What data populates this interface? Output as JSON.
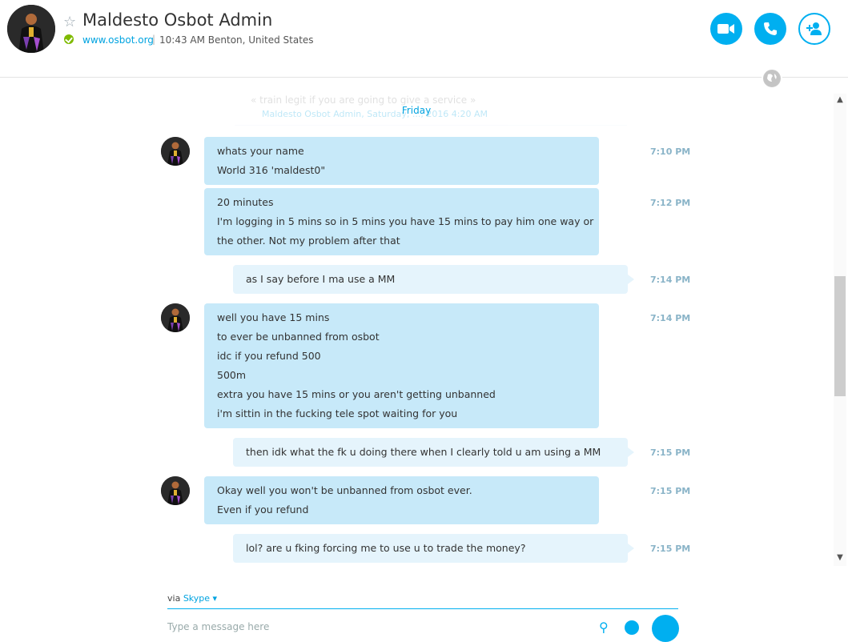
{
  "header": {
    "title": "Maldesto Osbot Admin",
    "website": "www.osbot.org",
    "separator": "|",
    "location": "10:43 AM Benton, United States"
  },
  "icons": {
    "star": "star-icon",
    "status": "online-status-icon",
    "video": "video-call-icon",
    "call": "phone-icon",
    "add": "add-person-icon",
    "globe": "globe-icon",
    "attach": "paperclip-icon",
    "emoji": "emoji-icon",
    "send": "send-icon"
  },
  "colors": {
    "accent": "#00aff0",
    "incoming_bubble": "#c7e9f9",
    "outgoing_bubble": "#e5f4fc",
    "online": "#7fba00"
  },
  "quote": {
    "text": "« train legit if you are going to give a service »",
    "meta": "Maldesto Osbot Admin, Saturday, ..., 2016 4:20 AM"
  },
  "day_separator": "Friday",
  "messages": [
    {
      "direction": "incoming",
      "lines": [
        "whats your name",
        "World 316 'maldest0\""
      ],
      "time": "7:10 PM"
    },
    {
      "direction": "incoming",
      "lines": [
        "20 minutes",
        "I'm logging in 5 mins so in 5 mins you have 15 mins to pay him one way or",
        "the other. Not my problem after that"
      ],
      "time": "7:12 PM"
    },
    {
      "direction": "outgoing",
      "lines": [
        "as I say before I ma use a MM"
      ],
      "time": "7:14 PM"
    },
    {
      "direction": "incoming",
      "lines": [
        "well you have 15 mins",
        "to ever be unbanned from osbot",
        "idc if you refund 500",
        "500m",
        "extra you have 15 mins or you aren't getting unbanned",
        "i'm sittin in the fucking tele spot waiting for you"
      ],
      "time": "7:14 PM"
    },
    {
      "direction": "outgoing",
      "lines": [
        "then idk what the fk u doing there when I clearly told u am using a MM"
      ],
      "time": "7:15 PM"
    },
    {
      "direction": "incoming",
      "lines": [
        "Okay well you won't be unbanned from osbot ever.",
        "Even if you refund"
      ],
      "time": "7:15 PM"
    },
    {
      "direction": "outgoing",
      "lines": [
        "lol? are u fking forcing me to use u to trade the money?"
      ],
      "time": "7:15 PM"
    }
  ],
  "composer": {
    "via_label": "via",
    "via_service": "Skype ▾",
    "placeholder": "Type a message here"
  }
}
